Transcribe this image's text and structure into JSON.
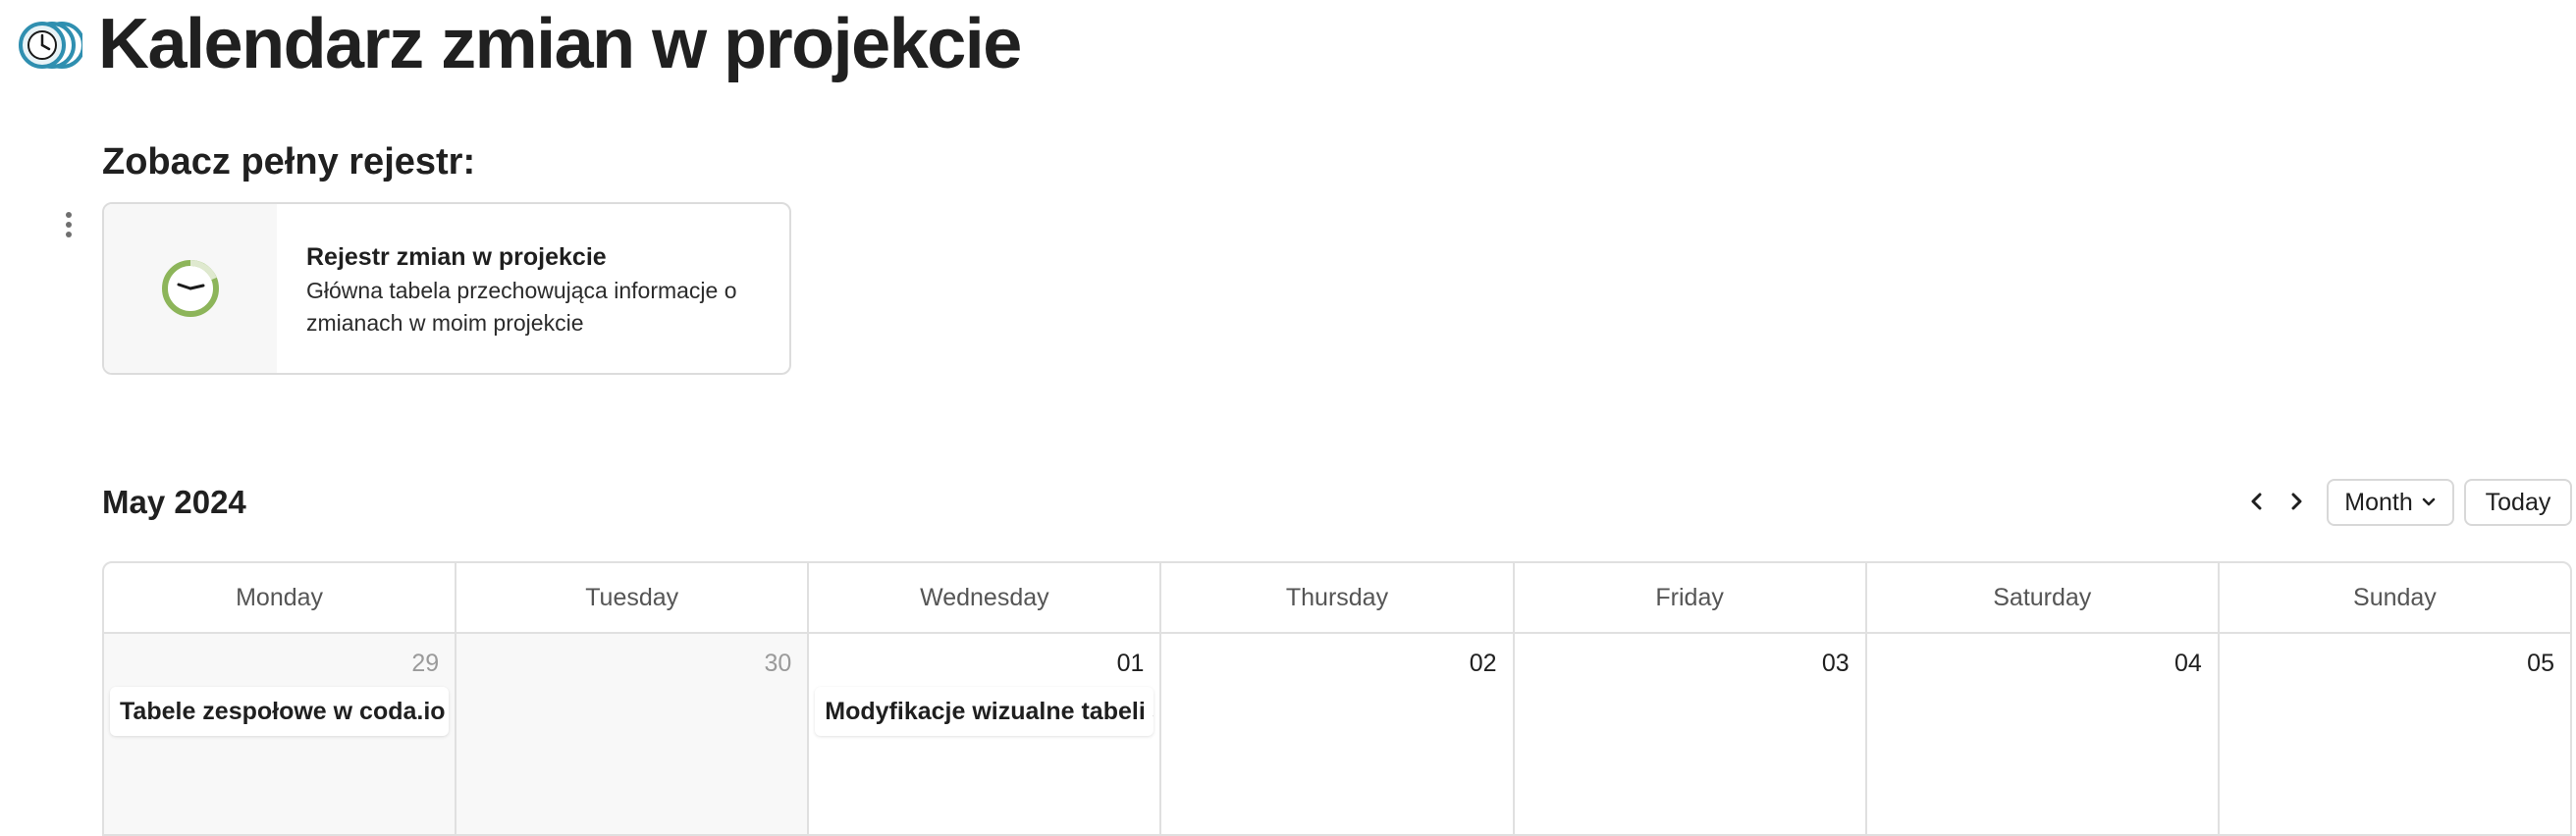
{
  "page": {
    "title": "Kalendarz zmian w projekcie",
    "subheading": "Zobacz pełny rejestr:"
  },
  "card": {
    "title": "Rejestr zmian w projekcie",
    "description_line1": "Główna tabela przechowująca informacje o",
    "description_line2": "zmianach w moim projekcie",
    "icon": "clock-icon"
  },
  "calendar": {
    "month_label": "May 2024",
    "view": "Month",
    "today_label": "Today",
    "weekdays": [
      "Monday",
      "Tuesday",
      "Wednesday",
      "Thursday",
      "Friday",
      "Saturday",
      "Sunday"
    ],
    "days": [
      {
        "num": "29",
        "event": "Tabele zespołowe w coda.io"
      },
      {
        "num": "30",
        "event": ""
      },
      {
        "num": "01",
        "event": "Modyfikacje wizualne tabeli s"
      },
      {
        "num": "02",
        "event": ""
      },
      {
        "num": "03",
        "event": ""
      },
      {
        "num": "04",
        "event": ""
      },
      {
        "num": "05",
        "event": ""
      }
    ]
  },
  "colors": {
    "icon_blue": "#2f8fb0",
    "icon_green": "#8db55a",
    "border": "#e0e0e0",
    "outside_bg": "#f8f8f8"
  }
}
